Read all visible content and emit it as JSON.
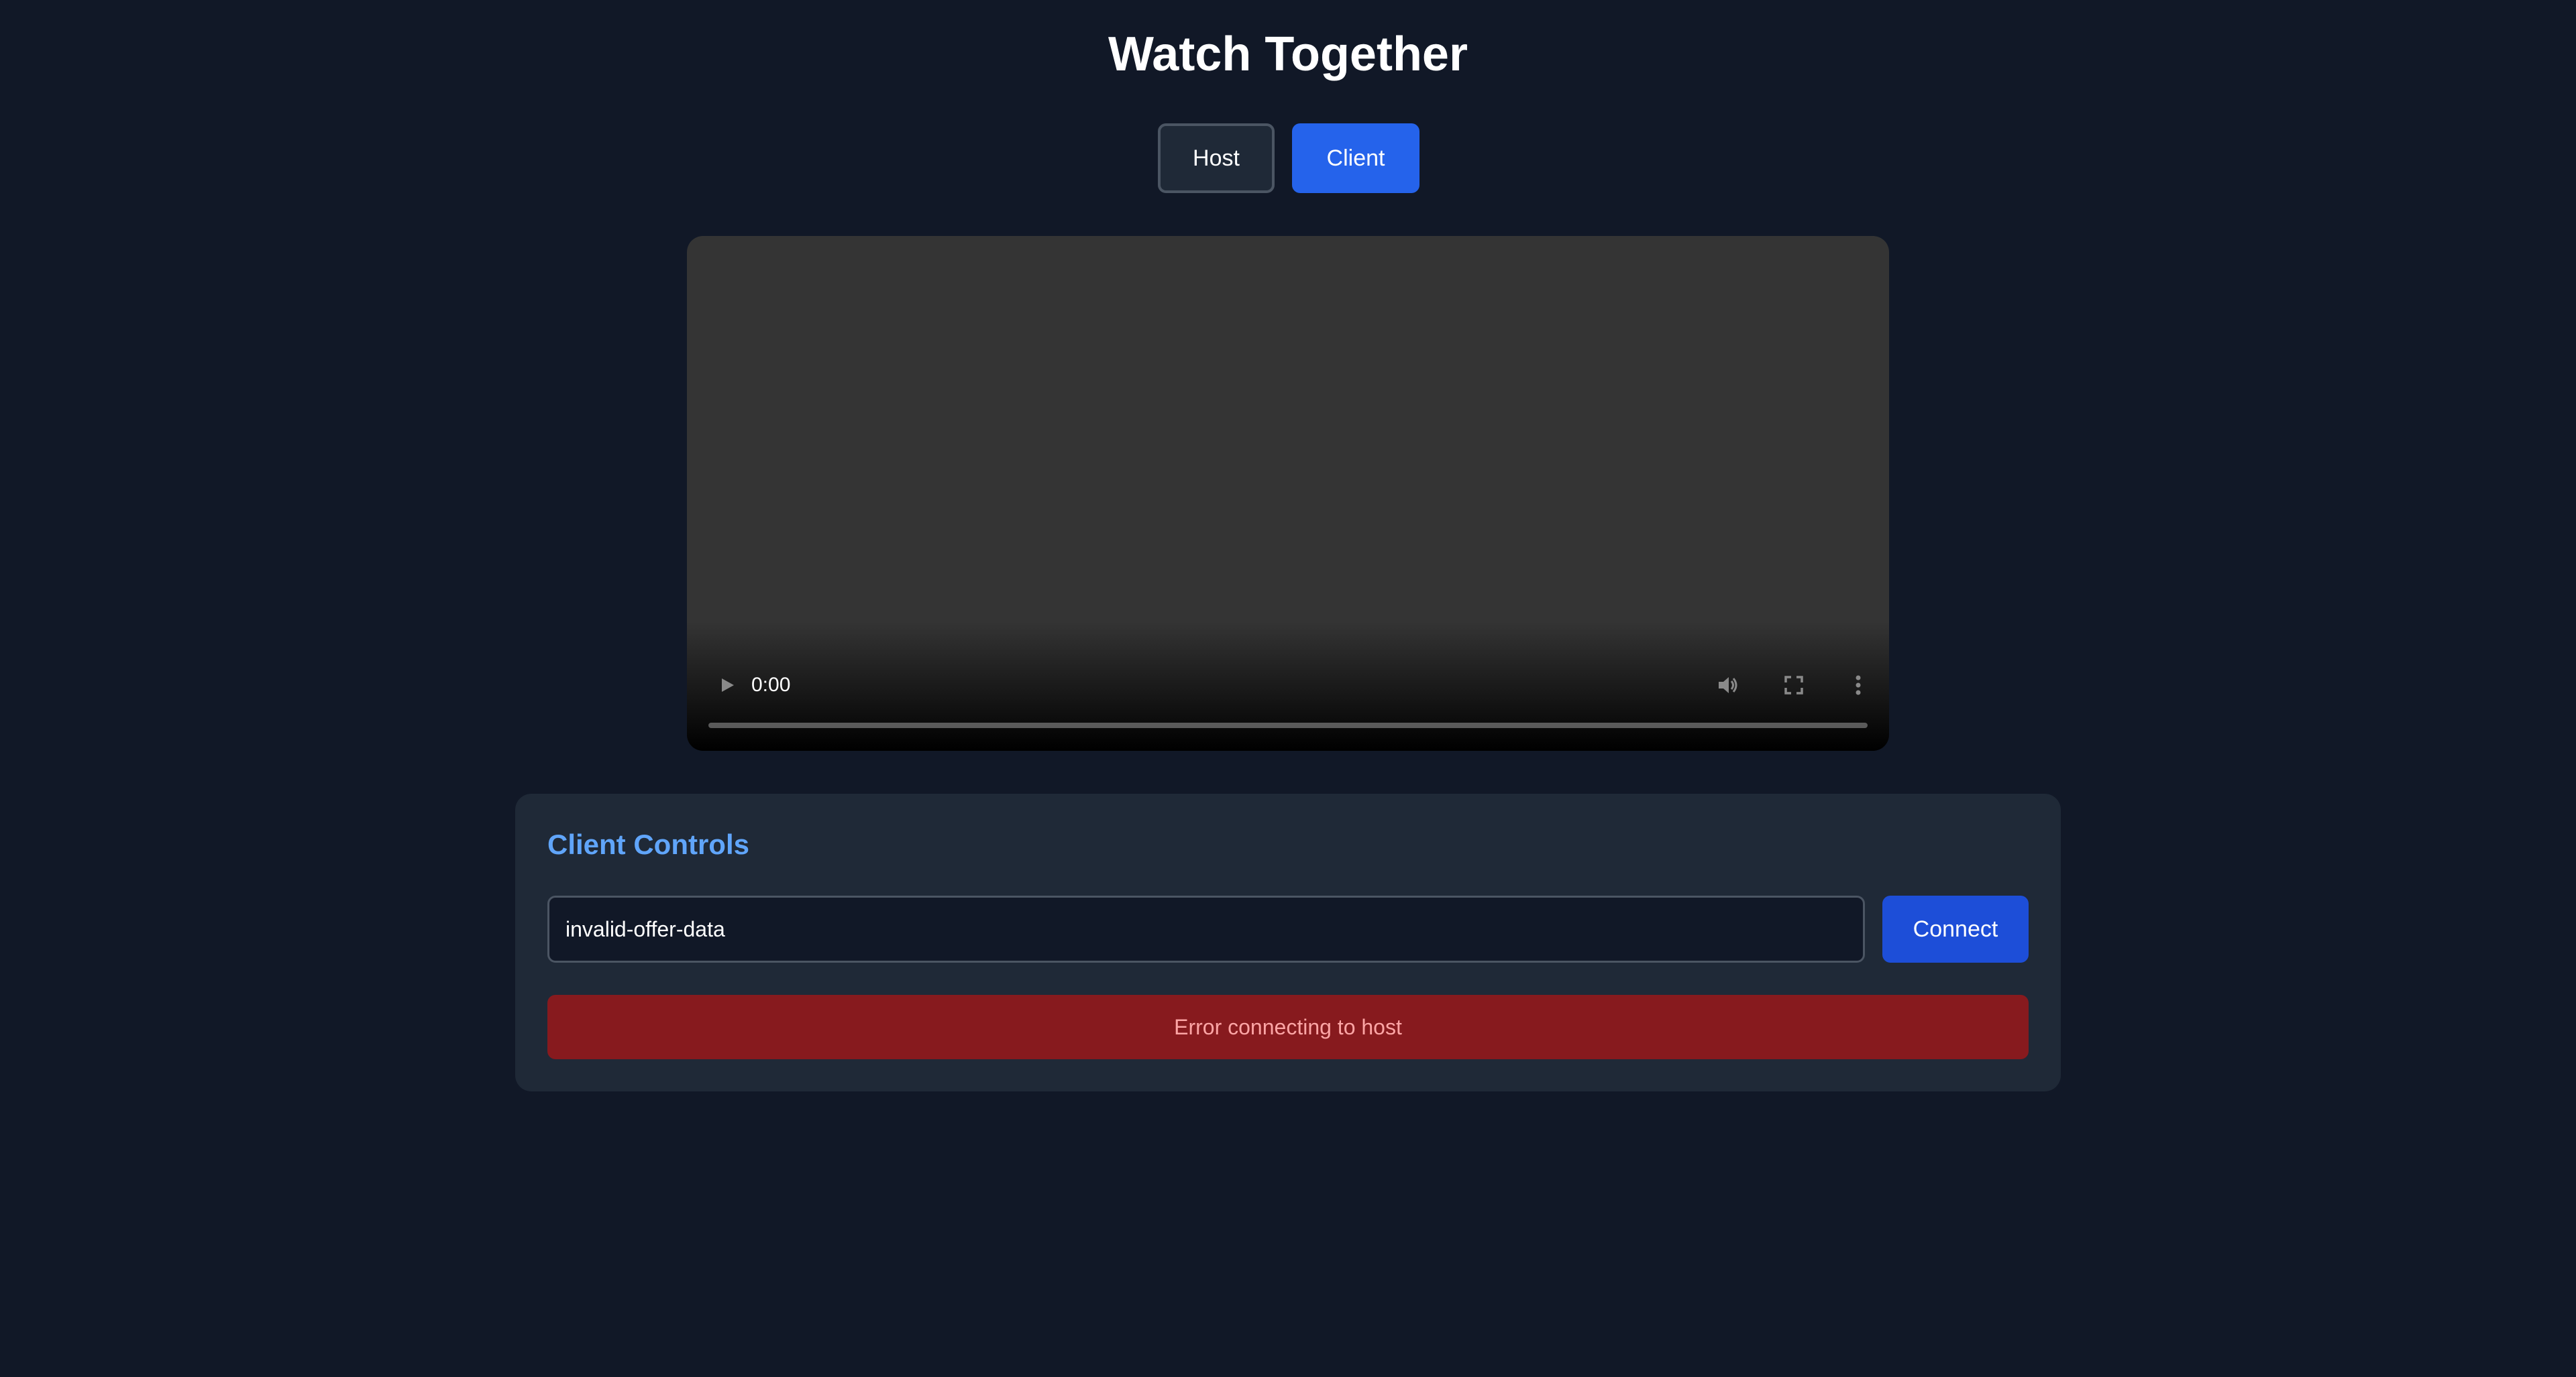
{
  "app": {
    "title": "Watch Together"
  },
  "mode_toggle": {
    "host_label": "Host",
    "client_label": "Client",
    "active": "Client"
  },
  "video_player": {
    "current_time": "0:00",
    "progress": 0,
    "icons": [
      "play-icon",
      "volume-icon",
      "fullscreen-icon",
      "more-options-icon"
    ]
  },
  "client_controls": {
    "title": "Client Controls",
    "offer_input_value": "invalid-offer-data",
    "connect_label": "Connect",
    "error_message": "Error connecting to host"
  },
  "colors": {
    "background": "#111827",
    "panel": "#1f2937",
    "accent": "#2563eb",
    "panel_title": "#60a5fa",
    "error_bg": "#871a1e",
    "error_text": "#fca5a5"
  }
}
